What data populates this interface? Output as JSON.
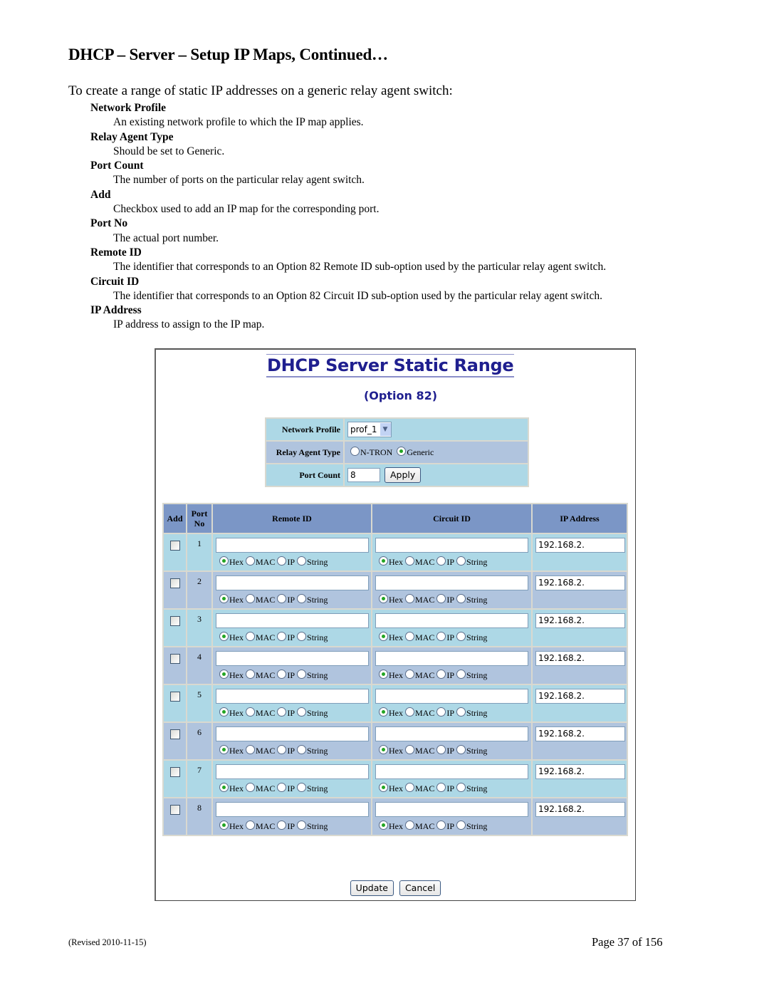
{
  "document": {
    "title": "DHCP – Server – Setup IP Maps, Continued…",
    "intro": "To create a range of static IP addresses on a generic relay agent switch:",
    "definitions": [
      {
        "term": "Network Profile",
        "desc": "An existing network profile to which the IP map applies."
      },
      {
        "term": "Relay Agent Type",
        "desc": "Should be set to Generic."
      },
      {
        "term": "Port Count",
        "desc": "The number of ports on the particular relay agent switch."
      },
      {
        "term": "Add",
        "desc": "Checkbox used to add an IP map for the corresponding port."
      },
      {
        "term": "Port No",
        "desc": "The actual port number."
      },
      {
        "term": "Remote ID",
        "desc": "The identifier that corresponds to an Option 82 Remote ID sub-option used by the particular relay agent switch."
      },
      {
        "term": "Circuit ID",
        "desc": "The identifier that corresponds to an Option 82 Circuit ID sub-option used by the particular relay agent switch."
      },
      {
        "term": "IP Address",
        "desc": "IP address to assign to the IP map."
      }
    ],
    "footer": {
      "revised": "(Revised 2010-11-15)",
      "page": "Page 37 of 156"
    }
  },
  "ui": {
    "title": "DHCP Server Static Range",
    "subtitle": "(Option 82)",
    "settings": {
      "network_profile_label": "Network Profile",
      "network_profile_value": "prof_1",
      "relay_agent_type_label": "Relay Agent Type",
      "relay_options": [
        {
          "label": "N-TRON",
          "selected": false
        },
        {
          "label": "Generic",
          "selected": true
        }
      ],
      "port_count_label": "Port Count",
      "port_count_value": "8",
      "apply_label": "Apply"
    },
    "table": {
      "headers": {
        "add": "Add",
        "port_no": "Port No",
        "remote_id": "Remote ID",
        "circuit_id": "Circuit ID",
        "ip_address": "IP Address"
      },
      "id_format_options": [
        "Hex",
        "MAC",
        "IP",
        "String"
      ],
      "rows": [
        {
          "port": "1",
          "checked": false,
          "remote_id": "",
          "remote_format": "Hex",
          "circuit_id": "",
          "circuit_format": "Hex",
          "ip": "192.168.2."
        },
        {
          "port": "2",
          "checked": false,
          "remote_id": "",
          "remote_format": "Hex",
          "circuit_id": "",
          "circuit_format": "Hex",
          "ip": "192.168.2."
        },
        {
          "port": "3",
          "checked": false,
          "remote_id": "",
          "remote_format": "Hex",
          "circuit_id": "",
          "circuit_format": "Hex",
          "ip": "192.168.2."
        },
        {
          "port": "4",
          "checked": false,
          "remote_id": "",
          "remote_format": "Hex",
          "circuit_id": "",
          "circuit_format": "Hex",
          "ip": "192.168.2."
        },
        {
          "port": "5",
          "checked": false,
          "remote_id": "",
          "remote_format": "Hex",
          "circuit_id": "",
          "circuit_format": "Hex",
          "ip": "192.168.2."
        },
        {
          "port": "6",
          "checked": false,
          "remote_id": "",
          "remote_format": "Hex",
          "circuit_id": "",
          "circuit_format": "Hex",
          "ip": "192.168.2."
        },
        {
          "port": "7",
          "checked": false,
          "remote_id": "",
          "remote_format": "Hex",
          "circuit_id": "",
          "circuit_format": "Hex",
          "ip": "192.168.2."
        },
        {
          "port": "8",
          "checked": false,
          "remote_id": "",
          "remote_format": "Hex",
          "circuit_id": "",
          "circuit_format": "Hex",
          "ip": "192.168.2."
        }
      ]
    },
    "update_label": "Update",
    "cancel_label": "Cancel",
    "colors": {
      "title": "#1f1f8f",
      "header_bg": "#7b96c6",
      "row_odd_bg": "#add8e6",
      "row_even_bg": "#b0c4de",
      "radio_dot": "#23a523"
    }
  }
}
